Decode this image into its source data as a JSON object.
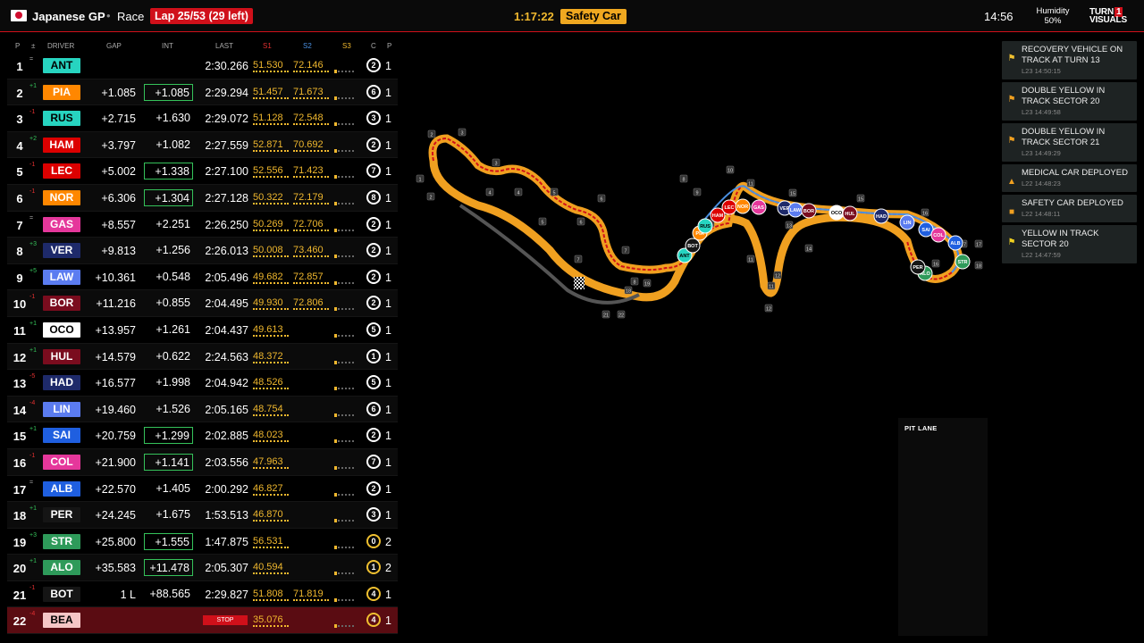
{
  "header": {
    "race_name": "Japanese GP",
    "session": "Race",
    "lap": "Lap 25/53 (29 left)",
    "race_clock": "1:17:22",
    "status": "Safety Car",
    "local_time": "14:56",
    "humidity_label": "Humidity",
    "humidity_value": "50%",
    "brand_line1": "TURN",
    "brand_num": "1",
    "brand_line2": "VISUALS"
  },
  "table": {
    "columns": {
      "p": "P",
      "pm": "±",
      "driver": "DRIVER",
      "gap": "GAP",
      "int": "INT",
      "last": "LAST",
      "s1": "S1",
      "s2": "S2",
      "s3": "S3",
      "c": "C",
      "pits": "P"
    },
    "column_colors": {
      "s1": "#e23030",
      "s2": "#4a90e2",
      "s3": "#f0b82e"
    },
    "rows": [
      {
        "pos": "1",
        "chg": "=",
        "dir": "eq",
        "code": "ANT",
        "color": "#27d4c0",
        "tc": "#000",
        "gap": "",
        "int": "",
        "int_hl": false,
        "last": "2:30.266",
        "s1": "51.530",
        "s2": "72.146",
        "stint": "2",
        "pits": "1"
      },
      {
        "pos": "2",
        "chg": "+1",
        "dir": "up",
        "code": "PIA",
        "color": "#ff8700",
        "tc": "#fff",
        "gap": "+1.085",
        "int": "+1.085",
        "int_hl": true,
        "last": "2:29.294",
        "s1": "51.457",
        "s2": "71.673",
        "stint": "6",
        "pits": "1"
      },
      {
        "pos": "3",
        "chg": "-1",
        "dir": "down",
        "code": "RUS",
        "color": "#27d4c0",
        "tc": "#000",
        "gap": "+2.715",
        "int": "+1.630",
        "int_hl": false,
        "last": "2:29.072",
        "s1": "51.128",
        "s2": "72.548",
        "stint": "3",
        "pits": "1"
      },
      {
        "pos": "4",
        "chg": "+2",
        "dir": "up",
        "code": "HAM",
        "color": "#dc0000",
        "tc": "#fff",
        "gap": "+3.797",
        "int": "+1.082",
        "int_hl": false,
        "last": "2:27.559",
        "s1": "52.871",
        "s2": "70.692",
        "stint": "2",
        "pits": "1"
      },
      {
        "pos": "5",
        "chg": "-1",
        "dir": "down",
        "code": "LEC",
        "color": "#dc0000",
        "tc": "#fff",
        "gap": "+5.002",
        "int": "+1.338",
        "int_hl": true,
        "last": "2:27.100",
        "s1": "52.556",
        "s2": "71.423",
        "stint": "7",
        "pits": "1"
      },
      {
        "pos": "6",
        "chg": "-1",
        "dir": "down",
        "code": "NOR",
        "color": "#ff8700",
        "tc": "#fff",
        "gap": "+6.306",
        "int": "+1.304",
        "int_hl": true,
        "last": "2:27.128",
        "s1": "50.322",
        "s2": "72.179",
        "stint": "8",
        "pits": "1"
      },
      {
        "pos": "7",
        "chg": "=",
        "dir": "eq",
        "code": "GAS",
        "color": "#e5379b",
        "tc": "#fff",
        "gap": "+8.557",
        "int": "+2.251",
        "int_hl": false,
        "last": "2:26.250",
        "s1": "50.269",
        "s2": "72.706",
        "stint": "2",
        "pits": "1"
      },
      {
        "pos": "8",
        "chg": "+3",
        "dir": "up",
        "code": "VER",
        "color": "#1e2a6a",
        "tc": "#fff",
        "gap": "+9.813",
        "int": "+1.256",
        "int_hl": false,
        "last": "2:26.013",
        "s1": "50.008",
        "s2": "73.460",
        "stint": "2",
        "pits": "1"
      },
      {
        "pos": "9",
        "chg": "+5",
        "dir": "up",
        "code": "LAW",
        "color": "#5b7cf0",
        "tc": "#fff",
        "gap": "+10.361",
        "int": "+0.548",
        "int_hl": false,
        "last": "2:05.496",
        "s1": "49.682",
        "s2": "72.857",
        "stint": "2",
        "pits": "1"
      },
      {
        "pos": "10",
        "chg": "-1",
        "dir": "down",
        "code": "BOR",
        "color": "#7a0c1e",
        "tc": "#fff",
        "gap": "+11.216",
        "int": "+0.855",
        "int_hl": false,
        "last": "2:04.495",
        "s1": "49.930",
        "s2": "72.806",
        "stint": "2",
        "pits": "1"
      },
      {
        "pos": "11",
        "chg": "+1",
        "dir": "up",
        "code": "OCO",
        "color": "#ffffff",
        "tc": "#000",
        "gap": "+13.957",
        "int": "+1.261",
        "int_hl": false,
        "last": "2:04.437",
        "s1": "49.613",
        "s2": "",
        "stint": "5",
        "pits": "1"
      },
      {
        "pos": "12",
        "chg": "+1",
        "dir": "up",
        "code": "HUL",
        "color": "#7a0c1e",
        "tc": "#fff",
        "gap": "+14.579",
        "int": "+0.622",
        "int_hl": false,
        "last": "2:24.563",
        "s1": "48.372",
        "s2": "",
        "stint": "1",
        "pits": "1"
      },
      {
        "pos": "13",
        "chg": "-5",
        "dir": "down",
        "code": "HAD",
        "color": "#1e2a6a",
        "tc": "#fff",
        "gap": "+16.577",
        "int": "+1.998",
        "int_hl": false,
        "last": "2:04.942",
        "s1": "48.526",
        "s2": "",
        "stint": "5",
        "pits": "1"
      },
      {
        "pos": "14",
        "chg": "-4",
        "dir": "down",
        "code": "LIN",
        "color": "#5b7cf0",
        "tc": "#fff",
        "gap": "+19.460",
        "int": "+1.526",
        "int_hl": false,
        "last": "2:05.165",
        "s1": "48.754",
        "s2": "",
        "stint": "6",
        "pits": "1"
      },
      {
        "pos": "15",
        "chg": "+1",
        "dir": "up",
        "code": "SAI",
        "color": "#1f5fe0",
        "tc": "#fff",
        "gap": "+20.759",
        "int": "+1.299",
        "int_hl": true,
        "last": "2:02.885",
        "s1": "48.023",
        "s2": "",
        "stint": "2",
        "pits": "1"
      },
      {
        "pos": "16",
        "chg": "-1",
        "dir": "down",
        "code": "COL",
        "color": "#e5379b",
        "tc": "#fff",
        "gap": "+21.900",
        "int": "+1.141",
        "int_hl": true,
        "last": "2:03.556",
        "s1": "47.963",
        "s2": "",
        "stint": "7",
        "pits": "1"
      },
      {
        "pos": "17",
        "chg": "=",
        "dir": "eq",
        "code": "ALB",
        "color": "#1f5fe0",
        "tc": "#fff",
        "gap": "+22.570",
        "int": "+1.405",
        "int_hl": false,
        "last": "2:00.292",
        "s1": "46.827",
        "s2": "",
        "stint": "2",
        "pits": "1"
      },
      {
        "pos": "18",
        "chg": "+1",
        "dir": "up",
        "code": "PER",
        "color": "#151515",
        "tc": "#fff",
        "gap": "+24.245",
        "int": "+1.675",
        "int_hl": false,
        "last": "1:53.513",
        "s1": "46.870",
        "s2": "",
        "stint": "3",
        "pits": "1"
      },
      {
        "pos": "19",
        "chg": "+3",
        "dir": "up",
        "code": "STR",
        "color": "#2e9a5a",
        "tc": "#fff",
        "gap": "+25.800",
        "int": "+1.555",
        "int_hl": true,
        "last": "1:47.875",
        "s1": "56.531",
        "s2": "",
        "stint": "0",
        "pits": "2",
        "stint_yellow": true
      },
      {
        "pos": "20",
        "chg": "+1",
        "dir": "up",
        "code": "ALO",
        "color": "#2e9a5a",
        "tc": "#fff",
        "gap": "+35.583",
        "int": "+11.478",
        "int_hl": true,
        "last": "2:05.307",
        "s1": "40.594",
        "s2": "",
        "stint": "1",
        "pits": "2",
        "stint_yellow": true
      },
      {
        "pos": "21",
        "chg": "-1",
        "dir": "down",
        "code": "BOT",
        "color": "#151515",
        "tc": "#fff",
        "gap": "1 L",
        "int": "+88.565",
        "int_hl": false,
        "last": "2:29.827",
        "s1": "51.808",
        "s2": "71.819",
        "stint": "4",
        "pits": "1",
        "stint_yellow": true
      },
      {
        "pos": "22",
        "chg": "-4",
        "dir": "down",
        "code": "BEA",
        "color": "#f5c6c6",
        "tc": "#000",
        "gap": "",
        "int": "",
        "int_hl": false,
        "last": "STOP",
        "stopped": true,
        "s1": "35.076",
        "s2": "",
        "stint": "4",
        "pits": "1",
        "stint_yellow": true
      }
    ]
  },
  "track": {
    "turns": [
      "1",
      "2",
      "2",
      "3",
      "3",
      "4",
      "4",
      "5",
      "5",
      "6",
      "6",
      "7",
      "7",
      "8",
      "8",
      "9",
      "9",
      "10",
      "11",
      "11",
      "11",
      "12",
      "12",
      "13",
      "14",
      "15",
      "15",
      "16",
      "16",
      "17",
      "17",
      "18",
      "18",
      "19",
      "21",
      "22"
    ],
    "cars": [
      "ANT",
      "PIA",
      "RUS",
      "HAM",
      "LEC",
      "NOR",
      "GAS",
      "VER",
      "LAW",
      "BOR",
      "OCO",
      "HUL",
      "HAD",
      "LIN",
      "SAI",
      "COL",
      "ALB",
      "STR",
      "ALO",
      "BOT",
      "PER"
    ]
  },
  "pit_lane": {
    "label": "PIT LANE"
  },
  "race_control": [
    {
      "icon": "recovery-vehicle-icon",
      "glyph": "⚑",
      "color": "#f0c030",
      "text": "RECOVERY VEHICLE ON TRACK AT TURN 13",
      "meta": "L23 14:50:15"
    },
    {
      "icon": "flag-icon",
      "glyph": "⚑",
      "color": "#f0a020",
      "text": "DOUBLE YELLOW IN TRACK SECTOR 20",
      "meta": "L23 14:49:58"
    },
    {
      "icon": "flag-icon",
      "glyph": "⚑",
      "color": "#f0a020",
      "text": "DOUBLE YELLOW IN TRACK SECTOR 21",
      "meta": "L23 14:49:29"
    },
    {
      "icon": "warning-icon",
      "glyph": "▲",
      "color": "#f0a020",
      "text": "MEDICAL CAR DEPLOYED",
      "meta": "L22 14:48:23"
    },
    {
      "icon": "safety-car-icon",
      "glyph": "■",
      "color": "#f0a020",
      "text": "SAFETY CAR DEPLOYED",
      "meta": "L22 14:48:11"
    },
    {
      "icon": "flag-icon",
      "glyph": "⚑",
      "color": "#f0d020",
      "text": "YELLOW IN TRACK SECTOR 20",
      "meta": "L22 14:47:59"
    }
  ]
}
